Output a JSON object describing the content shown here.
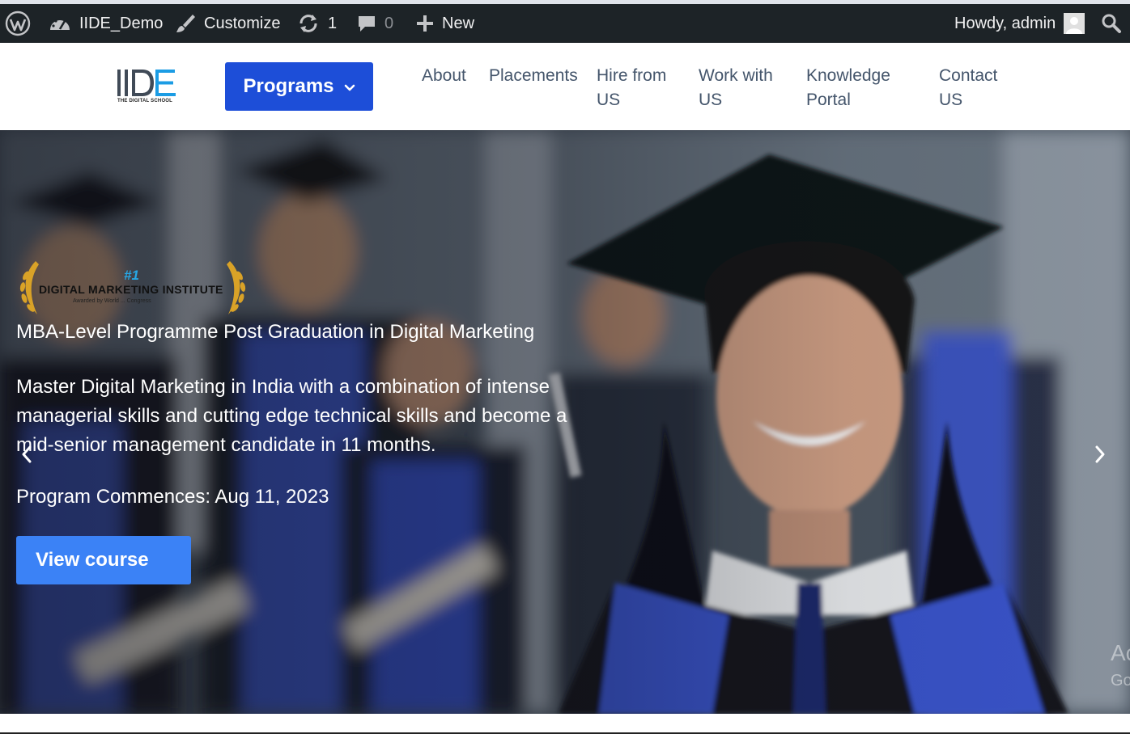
{
  "admin_bar": {
    "site_name": "IIDE_Demo",
    "customize_label": "Customize",
    "updates_count": "1",
    "comments_count": "0",
    "new_label": "New",
    "greeting": "Howdy, admin"
  },
  "header": {
    "logo_text": "IIDE",
    "logo_subtext": "THE DIGITAL SCHOOL",
    "programs_label": "Programs",
    "nav": [
      {
        "line1": "About",
        "line2": ""
      },
      {
        "line1": "Placements",
        "line2": ""
      },
      {
        "line1": "Hire from",
        "line2": "US"
      },
      {
        "line1": "Work with",
        "line2": "US"
      },
      {
        "line1": "Knowledge",
        "line2": "Portal"
      },
      {
        "line1": "Contact",
        "line2": "US"
      }
    ]
  },
  "hero": {
    "award_rank": "#1",
    "award_title": "DIGITAL MARKETING INSTITUTE",
    "award_sub": "Awarded by World ... Congress",
    "title": "MBA-Level Programme Post Graduation in Digital Marketing",
    "description": "Master Digital Marketing in India with a combination of intense managerial skills and cutting edge technical skills and become a mid-senior management candidate in 11 months.",
    "commence": "Program Commences: Aug 11, 2023",
    "cta": "View course",
    "watermark_line1": "Ac",
    "watermark_line2": "Go"
  },
  "colors": {
    "admin_bar": "#1d2327",
    "programs_button": "#1d4ed8",
    "cta_button": "#3b82f6",
    "nav_text": "#44556b"
  },
  "icons": {
    "wordpress": "wordpress-icon",
    "dashboard": "dashboard-icon",
    "customize": "brush-icon",
    "updates": "refresh-icon",
    "comments": "comment-icon",
    "new": "plus-icon",
    "avatar": "avatar-icon",
    "search": "search-icon",
    "programs": "chevron-down-icon",
    "prev": "chevron-left-icon",
    "next": "chevron-right-icon"
  }
}
